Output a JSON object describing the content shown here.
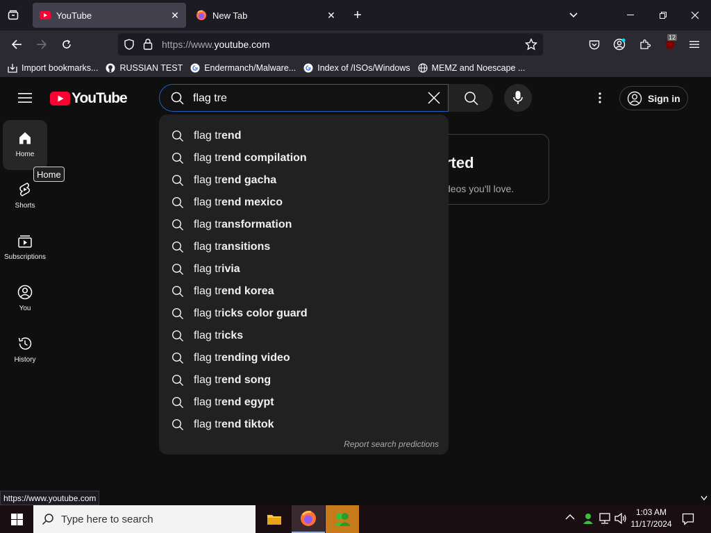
{
  "browser": {
    "tabs": [
      {
        "title": "YouTube",
        "active": true
      },
      {
        "title": "New Tab",
        "active": false
      }
    ],
    "url_prefix": "https://www.",
    "url_domain": "youtube.com",
    "extension_badge": "12",
    "bookmarks": [
      {
        "label": "Import bookmarks...",
        "icon": "import-icon"
      },
      {
        "label": "RUSSIAN TEST",
        "icon": "github-icon"
      },
      {
        "label": "Endermanch/Malware...",
        "icon": "google-icon"
      },
      {
        "label": "Index of /ISOs/Windows",
        "icon": "google-icon"
      },
      {
        "label": "MEMZ and Noescape ...",
        "icon": "globe-icon"
      }
    ],
    "status_url": "https://www.youtube.com"
  },
  "youtube": {
    "logo_text": "YouTube",
    "search_value": "flag tre",
    "sign_in": "Sign in",
    "sidebar": [
      {
        "label": "Home",
        "icon": "home-icon",
        "active": true
      },
      {
        "label": "Shorts",
        "icon": "shorts-icon",
        "active": false
      },
      {
        "label": "Subscriptions",
        "icon": "subscriptions-icon",
        "active": false
      },
      {
        "label": "You",
        "icon": "you-icon",
        "active": false
      },
      {
        "label": "History",
        "icon": "history-icon",
        "active": false
      }
    ],
    "tooltip": "Home",
    "get_started_title": "rted",
    "get_started_sub": "deos you'll love.",
    "suggestions": [
      {
        "typed": "flag tr",
        "rest": "end"
      },
      {
        "typed": "flag tr",
        "rest": "end compilation"
      },
      {
        "typed": "flag tr",
        "rest": "end gacha"
      },
      {
        "typed": "flag tr",
        "rest": "end mexico"
      },
      {
        "typed": "flag tr",
        "rest": "ansformation"
      },
      {
        "typed": "flag tr",
        "rest": "ansitions"
      },
      {
        "typed": "flag tr",
        "rest": "ivia"
      },
      {
        "typed": "flag tr",
        "rest": "end korea"
      },
      {
        "typed": "flag tr",
        "rest": "icks color guard"
      },
      {
        "typed": "flag tr",
        "rest": "icks"
      },
      {
        "typed": "flag tr",
        "rest": "ending video"
      },
      {
        "typed": "flag tr",
        "rest": "end song"
      },
      {
        "typed": "flag tr",
        "rest": "end egypt"
      },
      {
        "typed": "flag tr",
        "rest": "end tiktok"
      }
    ],
    "report_text": "Report search predictions"
  },
  "taskbar": {
    "search_placeholder": "Type here to search",
    "time": "1:03 AM",
    "date": "11/17/2024"
  }
}
